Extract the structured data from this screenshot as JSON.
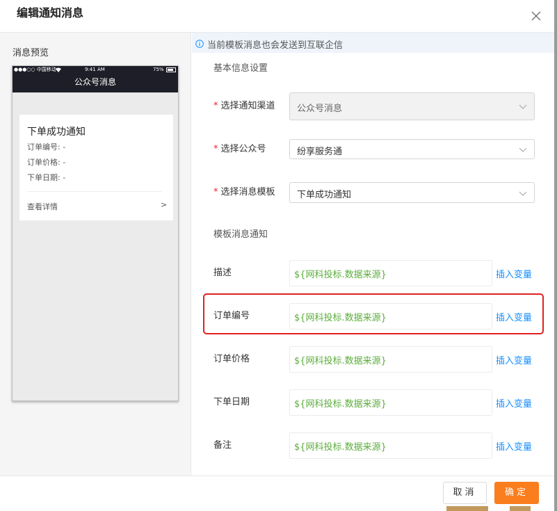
{
  "dialog": {
    "title": "编辑通知消息",
    "close_icon": "close-icon"
  },
  "preview": {
    "label": "消息预览",
    "phone": {
      "status_carrier": "●●●○○ 中国移动",
      "status_time": "9:41 AM",
      "status_battery": "75%",
      "nav_title": "公众号消息"
    },
    "card": {
      "title": "下单成功通知",
      "rows": [
        "订单编号: -",
        "订单价格: -",
        "下单日期: -"
      ],
      "detail_label": "查看详情",
      "arrow": ">"
    }
  },
  "notice": {
    "icon": "info-icon",
    "text": "当前模板消息也会发送到互联企信"
  },
  "form": {
    "basic_title": "基本信息设置",
    "required_mark": "*",
    "channel": {
      "label": "选择通知渠道",
      "value": "公众号消息",
      "disabled": true
    },
    "account": {
      "label": "选择公众号",
      "value": "纷享服务通"
    },
    "template": {
      "label": "选择消息模板",
      "value": "下单成功通知"
    },
    "template_title": "模板消息通知",
    "insert_label": "插入变量",
    "variables": [
      {
        "label": "描述",
        "value": "${网科投标.数据来源}"
      },
      {
        "label": "订单编号",
        "value": "${网科投标.数据来源}",
        "highlighted": true
      },
      {
        "label": "订单价格",
        "value": "${网科投标.数据来源}"
      },
      {
        "label": "下单日期",
        "value": "${网科投标.数据来源}"
      },
      {
        "label": "备注",
        "value": "${网科投标.数据来源}"
      }
    ]
  },
  "footer": {
    "cancel_label": "取消",
    "ok_label": "确定"
  },
  "colors": {
    "accent": "#fa7d1e",
    "link": "#1890ff",
    "variable_text": "#5cad3c",
    "highlight": "#e02020"
  }
}
